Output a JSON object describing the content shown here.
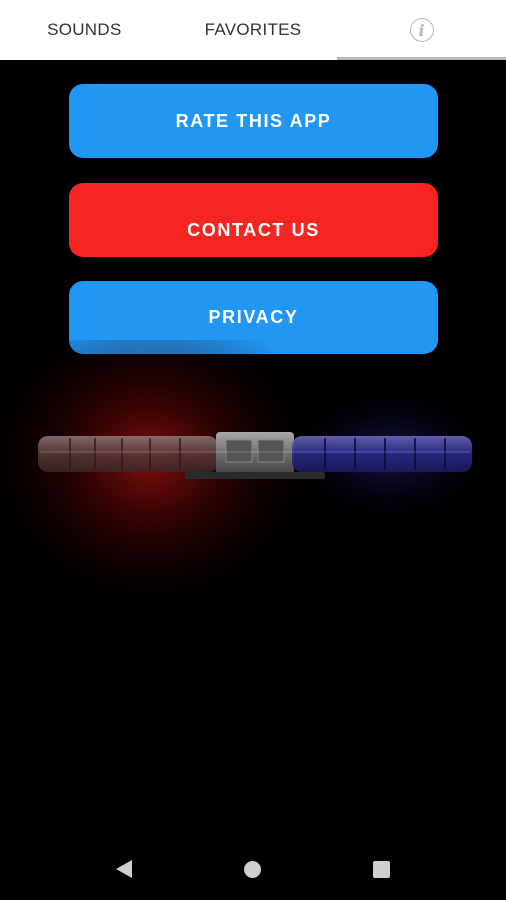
{
  "tabs": [
    {
      "label": "SOUNDS"
    },
    {
      "label": "FAVORITES"
    },
    {
      "label": "i"
    }
  ],
  "buttons": {
    "rate": "RATE THIS APP",
    "contact": "CONTACT US",
    "privacy": "PRIVACY"
  },
  "colors": {
    "blue": "#2196f3",
    "red": "#f72424"
  },
  "icons": {
    "info": "info-icon",
    "back": "back-icon",
    "home": "home-icon",
    "recents": "recents-icon"
  }
}
